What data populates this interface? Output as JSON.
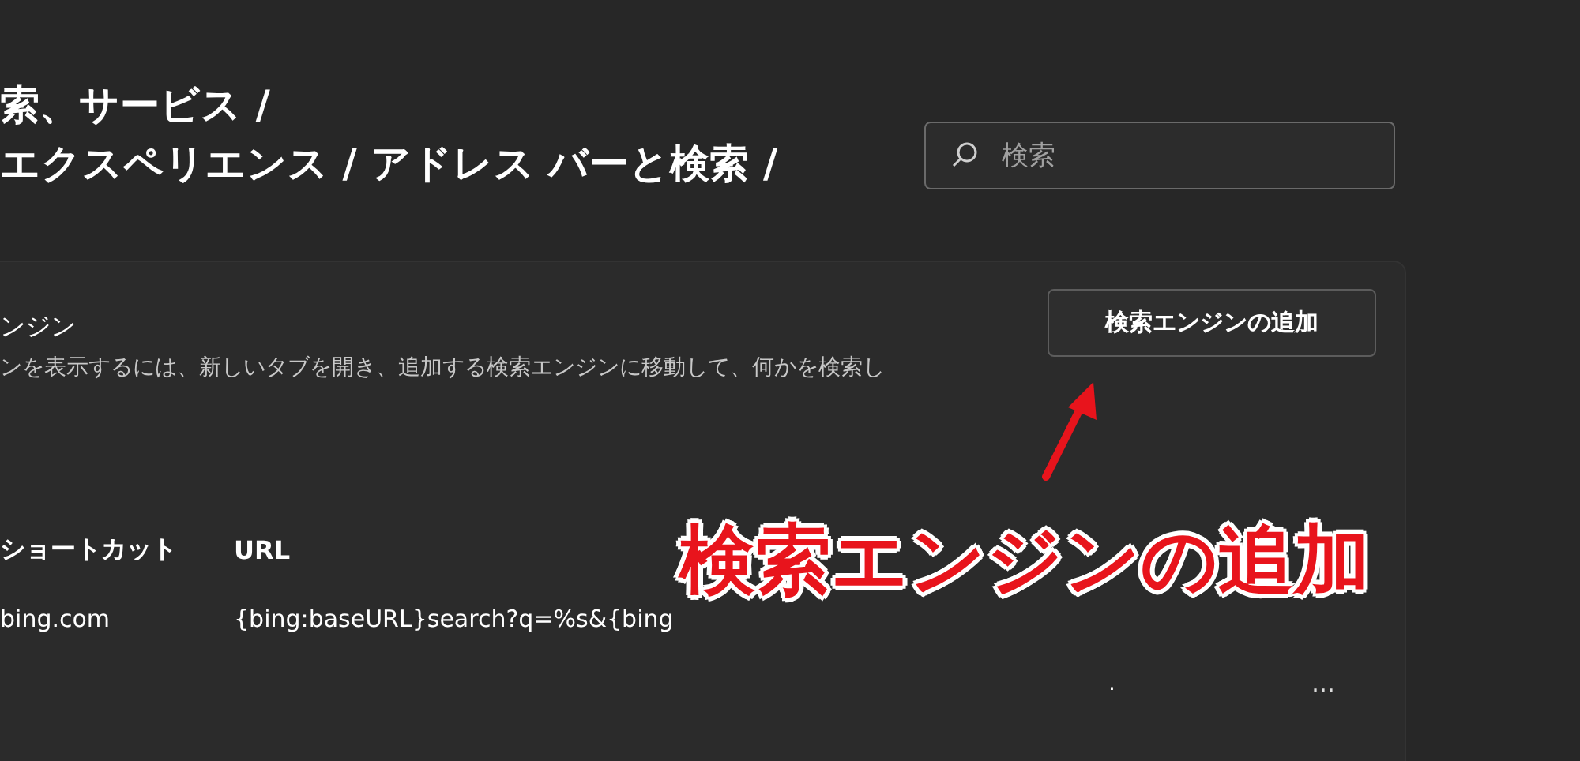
{
  "breadcrumb": [
    "索、サービス /",
    "エクスペリエンス / アドレス バーと検索 /"
  ],
  "search": {
    "placeholder": "検索"
  },
  "section": {
    "title": "ンジン",
    "description": "ンを表示するには、新しいタブを開き、追加する検索エンジンに移動して、何かを検索し",
    "button": "検索エンジンの追加"
  },
  "table": {
    "columns": [
      "ショートカット",
      "URL"
    ],
    "rows": [
      {
        "shortcut": "bing.com",
        "url": "{bing:baseURL}search?q=%s&{bing"
      }
    ],
    "footer_mark": ".",
    "more": "…"
  },
  "annotation": {
    "text": "検索エンジンの追加"
  }
}
